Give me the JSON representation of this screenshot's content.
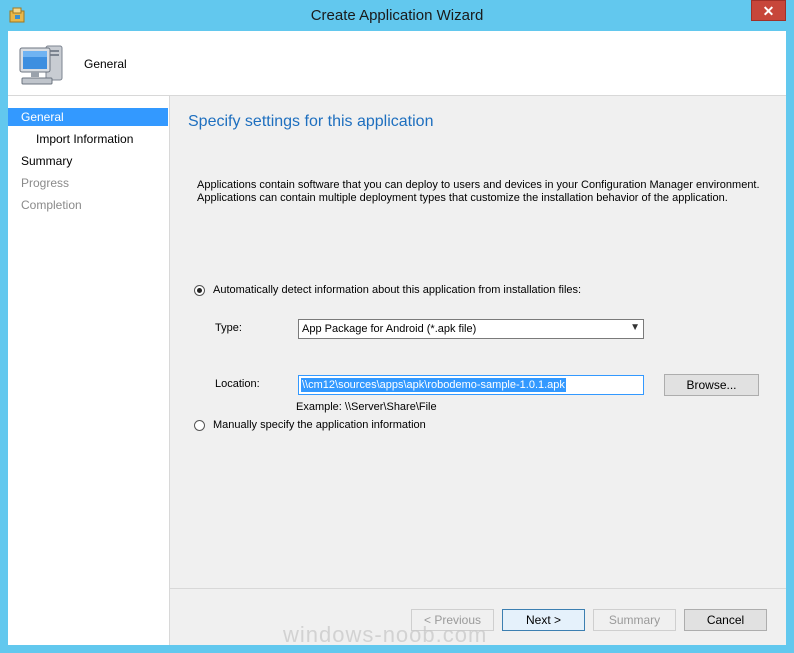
{
  "window": {
    "title": "Create Application Wizard",
    "close_glyph": "✕"
  },
  "header": {
    "label": "General",
    "icon": "computer-icon"
  },
  "nav": {
    "items": [
      {
        "label": "General",
        "state": "active"
      },
      {
        "label": "Import Information",
        "state": "normal",
        "sub": true
      },
      {
        "label": "Summary",
        "state": "normal"
      },
      {
        "label": "Progress",
        "state": "disabled"
      },
      {
        "label": "Completion",
        "state": "disabled"
      }
    ]
  },
  "main": {
    "heading": "Specify settings for this application",
    "description_line1": "Applications contain software that you can deploy to users and devices in your Configuration Manager environment.",
    "description_line2": "Applications can contain multiple deployment types that customize the installation behavior of the application.",
    "auto_detect_label": "Automatically detect information about this application from installation files:",
    "auto_detect_selected": true,
    "type_label": "Type:",
    "type_value": "App Package for Android (*.apk file)",
    "location_label": "Location:",
    "location_value": "\\\\cm12\\sources\\apps\\apk\\robodemo-sample-1.0.1.apk",
    "browse_label": "Browse...",
    "example_text": "Example: \\\\Server\\Share\\File",
    "manual_label": "Manually specify the application information",
    "manual_selected": false
  },
  "footer": {
    "previous_label": "< Previous",
    "next_label": "Next >",
    "summary_label": "Summary",
    "cancel_label": "Cancel"
  },
  "watermark": "windows-noob.com",
  "colors": {
    "accent": "#3399ff",
    "heading": "#1e6fbf",
    "titlebar": "#62c8ee",
    "close": "#c7463a"
  }
}
